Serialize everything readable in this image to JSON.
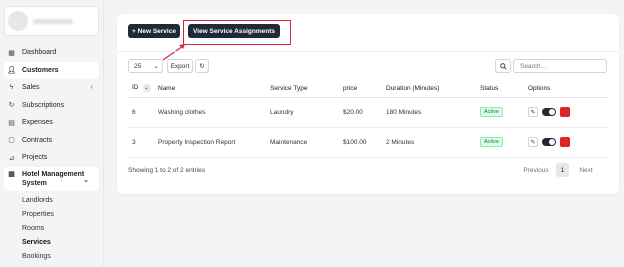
{
  "sidebar": {
    "items": [
      {
        "label": "Dashboard",
        "icon": "grid-icon"
      },
      {
        "label": "Customers",
        "icon": "user-icon"
      },
      {
        "label": "Sales",
        "icon": "lightning-icon"
      },
      {
        "label": "Subscriptions",
        "icon": "refresh-icon"
      },
      {
        "label": "Expenses",
        "icon": "document-icon"
      },
      {
        "label": "Contracts",
        "icon": "clipboard-icon"
      },
      {
        "label": "Projects",
        "icon": "chart-icon"
      }
    ],
    "hotel": {
      "label": "Hotel Management System"
    },
    "subitems": [
      "Landlords",
      "Properties",
      "Rooms",
      "Services",
      "Bookings"
    ]
  },
  "toolbar": {
    "new_service_label": "+ New Service",
    "view_assignments_label": "View Service Assignments"
  },
  "controls": {
    "page_size": "25",
    "export_label": "Export",
    "search_placeholder": "Search..."
  },
  "table": {
    "columns": [
      "ID",
      "Name",
      "Service Type",
      "price",
      "Duration (Minutes)",
      "Status",
      "Options"
    ],
    "rows": [
      {
        "id": "6",
        "name": "Washing clothes",
        "type": "Laundry",
        "price": "$20.00",
        "duration": "180 Minutes",
        "status": "Active"
      },
      {
        "id": "3",
        "name": "Property Inspection Report",
        "type": "Maintenance",
        "price": "$100.00",
        "duration": "2 Minutes",
        "status": "Active"
      }
    ]
  },
  "footer": {
    "showing": "Showing 1 to 2 of 2 entries",
    "previous": "Previous",
    "page": "1",
    "next": "Next"
  }
}
